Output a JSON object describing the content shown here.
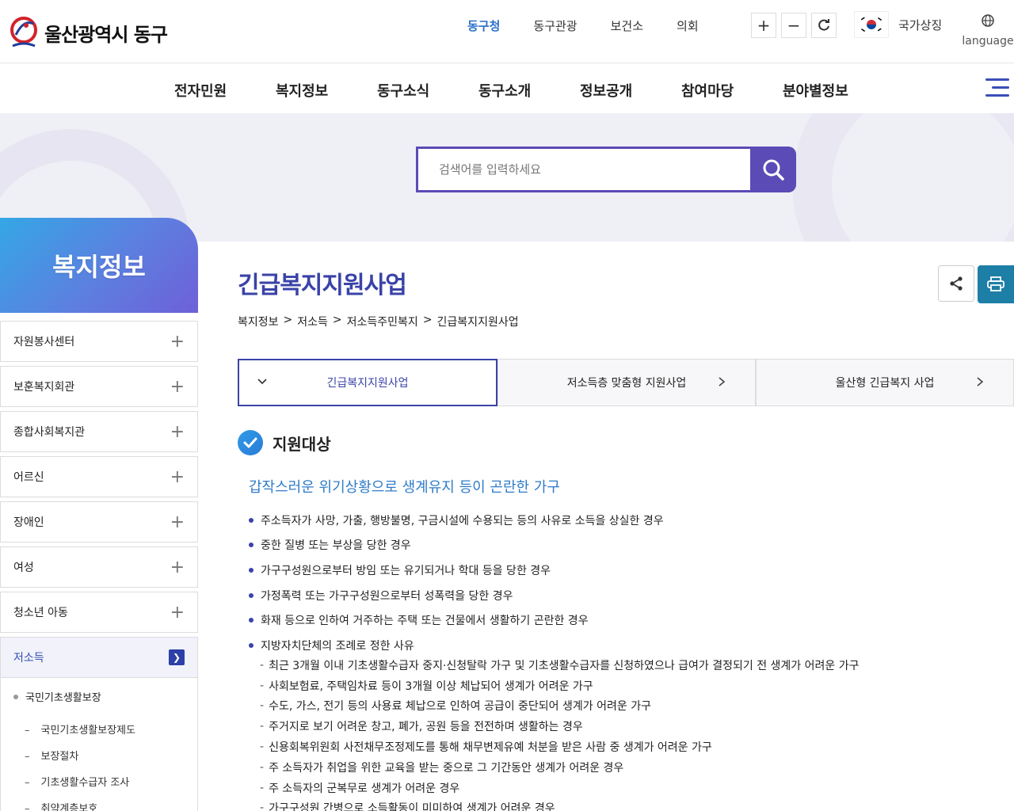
{
  "header": {
    "logo_text": "울산광역시 동구",
    "top_links": [
      {
        "label": "동구청",
        "active": true
      },
      {
        "label": "동구관광",
        "active": false
      },
      {
        "label": "보건소",
        "active": false
      },
      {
        "label": "의회",
        "active": false
      }
    ],
    "zoom": {
      "plus": "+",
      "minus": "−",
      "reset": "↻"
    },
    "symbol_label": "국가상징",
    "language_label": "language"
  },
  "mainnav": [
    "전자민원",
    "복지정보",
    "동구소식",
    "동구소개",
    "정보공개",
    "참여마당",
    "분야별정보"
  ],
  "search": {
    "placeholder": "검색어를 입력하세요"
  },
  "sidebar": {
    "title": "복지정보",
    "items": [
      {
        "label": "자원봉사센터",
        "icon": "+"
      },
      {
        "label": "보훈복지회관",
        "icon": "+"
      },
      {
        "label": "종합사회복지관",
        "icon": "+"
      },
      {
        "label": "어르신",
        "icon": "+"
      },
      {
        "label": "장애인",
        "icon": "+"
      },
      {
        "label": "여성",
        "icon": "+"
      },
      {
        "label": "청소년 아동",
        "icon": "+"
      }
    ],
    "active_item": {
      "label": "저소득"
    },
    "sub_level1": "국민기초생활보장",
    "sub_level2": [
      "국민기초생활보장제도",
      "보장절차",
      "기초생활수급자 조사",
      "취약계층보호"
    ]
  },
  "content": {
    "title": "긴급복지지원사업",
    "breadcrumb": [
      "복지정보",
      "저소득",
      "저소득주민복지",
      "긴급복지지원사업"
    ],
    "breadcrumb_sep": ">",
    "tabs": [
      "긴급복지지원사업",
      "저소득층 맞춤형 지원사업",
      "울산형 긴급복지 사업"
    ],
    "section_title": "지원대상",
    "subheading": "갑작스러운 위기상황으로 생계유지 등이 곤란한 가구",
    "bullets": [
      "주소득자가 사망, 가출, 행방불명, 구금시설에 수용되는 등의 사유로 소득을 상실한 경우",
      "중한 질병 또는 부상을 당한 경우",
      "가구구성원으로부터 방임 또는 유기되거나 학대 등을 당한 경우",
      "가정폭력 또는 가구구성원으로부터 성폭력을 당한 경우",
      "화재 등으로 인하여 거주하는 주택 또는 건물에서 생활하기 곤란한 경우",
      "지방자치단체의 조례로 정한 사유"
    ],
    "sub_bullets": [
      "최근 3개월 이내 기초생활수급자 중지·신청탈락 가구 및 기초생활수급자를 신청하였으나 급여가 결정되기 전 생계가 어려운 가구",
      "사회보험료, 주택임차료 등이 3개월 이상 체납되어 생계가 어려운 가구",
      "수도, 가스, 전기 등의 사용료 체납으로 인하여 공급이 중단되어 생계가 어려운 가구",
      "주거지로 보기 어려운 창고, 폐가, 공원 등을 전전하며 생활하는 경우",
      "신용회복위원회 사전채무조정제도를 통해 채무변제유예 처분을 받은 사람 중 생계가 어려운 가구",
      "주 소득자가 취업을 위한 교육을 받는 중으로 그 기간동안 생계가 어려운 경우",
      "주 소득자의 군복무로 생계가 어려운 경우",
      "가구구성원 간병으로 소득활동이 미미하여 생계가 어려운 경우"
    ]
  },
  "colors": {
    "brand": "#3a43a8",
    "accent_link": "#2f7cc8",
    "search": "#5b4bb6",
    "print": "#1d7fa6"
  }
}
